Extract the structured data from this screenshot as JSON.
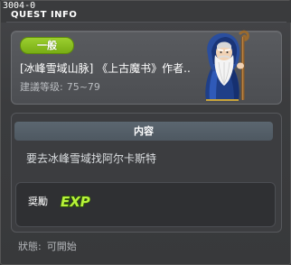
{
  "window": {
    "quest_id": "3004-0",
    "title": "QUEST INFO"
  },
  "quest": {
    "category_badge": "一般",
    "name": "[冰峰雪域山脉] 《上古魔书》作者..",
    "level_label": "建議等级:",
    "level_range": "75~79",
    "npc_icon": "old-wizard-npc-icon"
  },
  "content": {
    "header": "内容",
    "description": "要去冰峰雪域找阿尔卡斯特"
  },
  "reward": {
    "label": "奨勵",
    "icon": "exp-icon",
    "icon_text": "EXP"
  },
  "status": {
    "label": "狀態:",
    "value": "可開始"
  },
  "colors": {
    "badge_green": "#8cc12a",
    "exp_green": "#b8f23a",
    "header_bg": "#56616b"
  }
}
